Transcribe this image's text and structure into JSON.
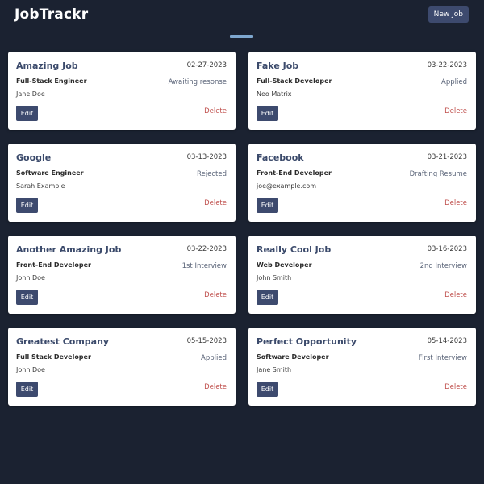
{
  "header": {
    "title": "JobTrackr",
    "new_job_label": "New Job"
  },
  "colors": {
    "background": "#1b2231",
    "accent": "#3d4a6e",
    "delete": "#c0504d",
    "divider": "#7ea7cf"
  },
  "jobs": [
    {
      "company": "Amazing Job",
      "date": "02-27-2023",
      "position": "Full-Stack Engineer",
      "status": "Awaiting resonse",
      "contact": "Jane Doe",
      "edit_label": "Edit",
      "delete_label": "Delete"
    },
    {
      "company": "Fake Job",
      "date": "03-22-2023",
      "position": "Full-Stack Developer",
      "status": "Applied",
      "contact": "Neo Matrix",
      "edit_label": "Edit",
      "delete_label": "Delete"
    },
    {
      "company": "Google",
      "date": "03-13-2023",
      "position": "Software Engineer",
      "status": "Rejected",
      "contact": "Sarah Example",
      "edit_label": "Edit",
      "delete_label": "Delete"
    },
    {
      "company": "Facebook",
      "date": "03-21-2023",
      "position": "Front-End Developer",
      "status": "Drafting Resume",
      "contact": "joe@example.com",
      "edit_label": "Edit",
      "delete_label": "Delete"
    },
    {
      "company": "Another Amazing Job",
      "date": "03-22-2023",
      "position": "Front-End Developer",
      "status": "1st Interview",
      "contact": "John Doe",
      "edit_label": "Edit",
      "delete_label": "Delete"
    },
    {
      "company": "Really Cool Job",
      "date": "03-16-2023",
      "position": "Web Developer",
      "status": "2nd Interview",
      "contact": "John Smith",
      "edit_label": "Edit",
      "delete_label": "Delete"
    },
    {
      "company": "Greatest Company",
      "date": "05-15-2023",
      "position": "Full Stack Developer",
      "status": "Applied",
      "contact": "John Doe",
      "edit_label": "Edit",
      "delete_label": "Delete"
    },
    {
      "company": "Perfect Opportunity",
      "date": "05-14-2023",
      "position": "Software Developer",
      "status": "First Interview",
      "contact": "Jane Smith",
      "edit_label": "Edit",
      "delete_label": "Delete"
    }
  ]
}
